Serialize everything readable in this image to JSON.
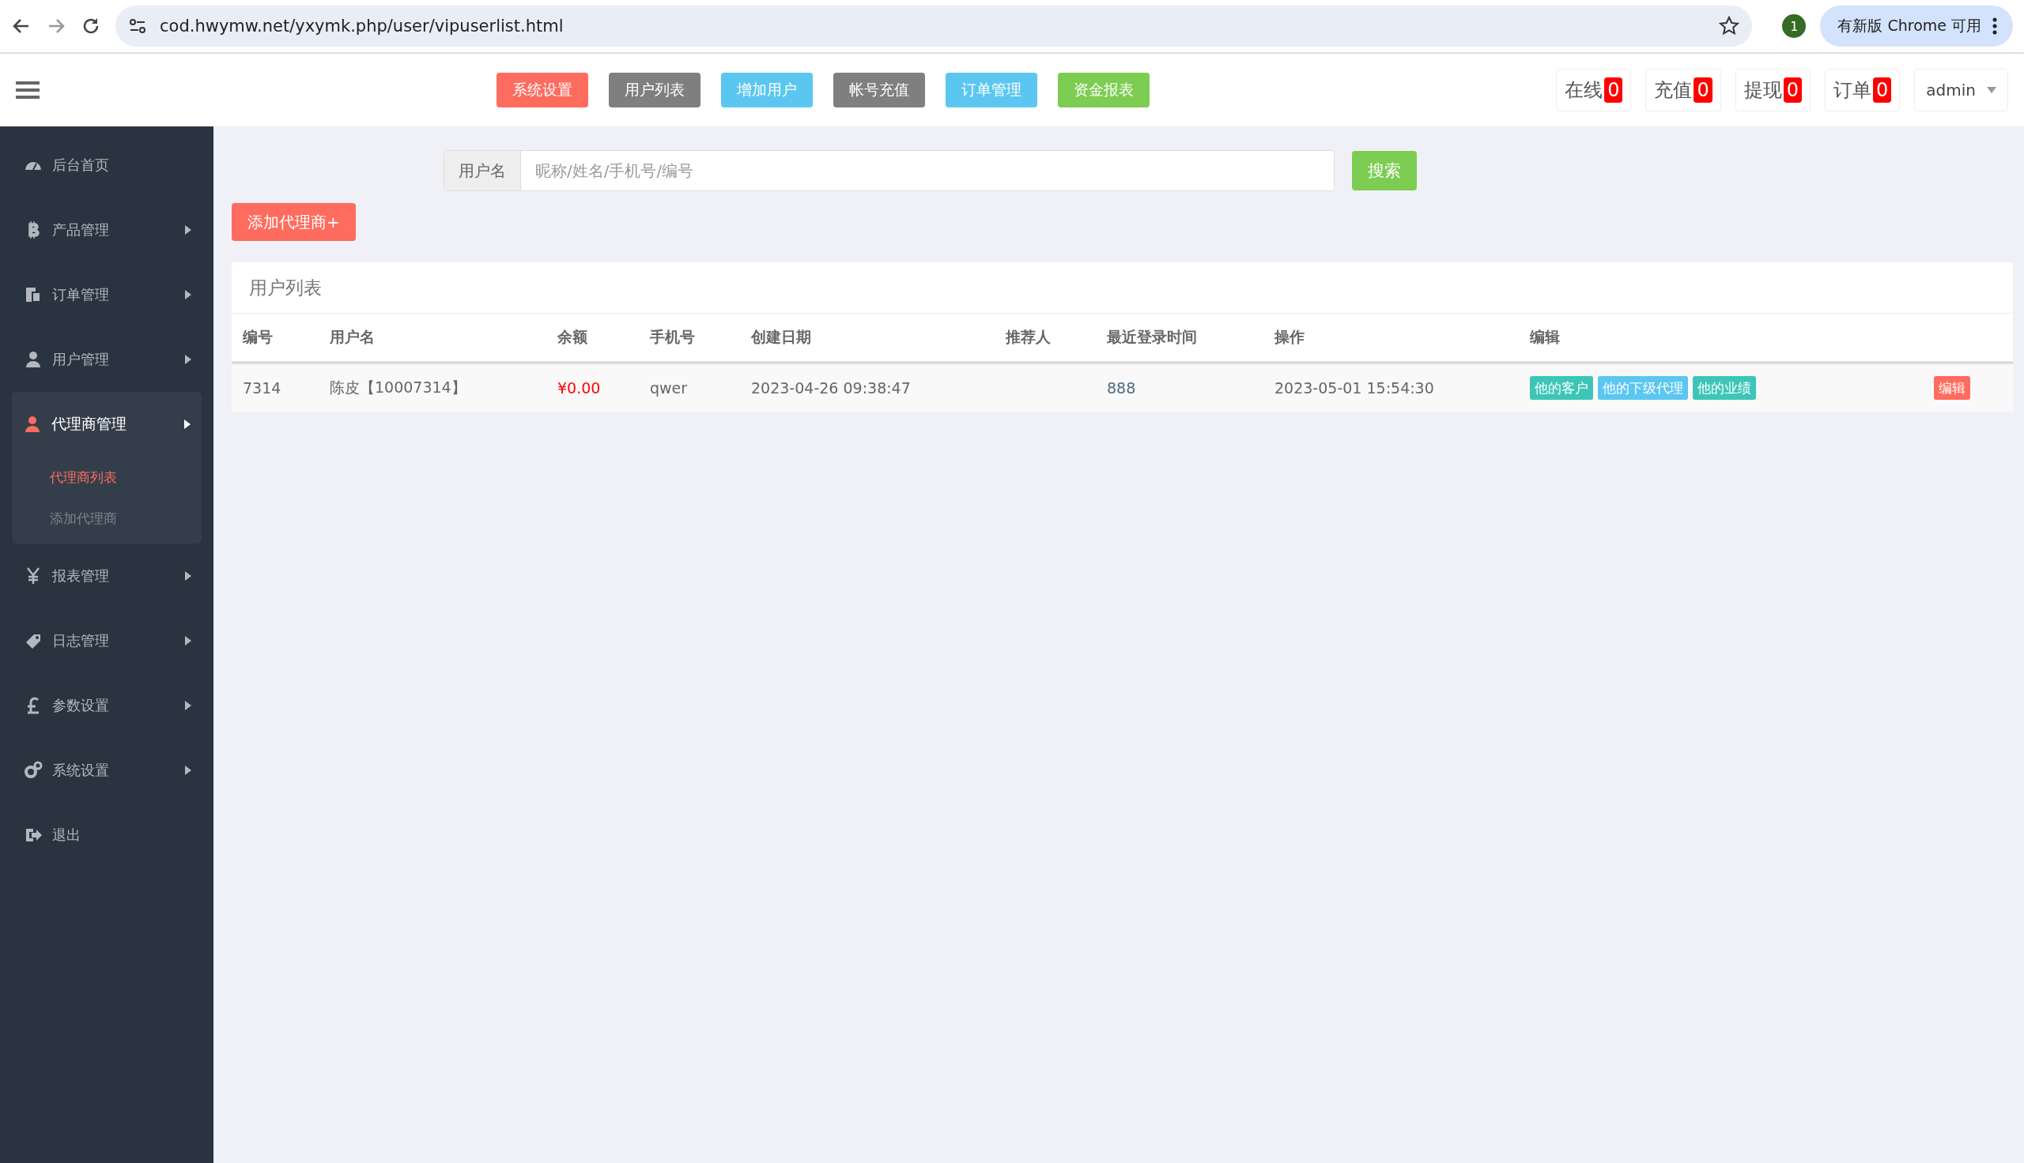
{
  "browser": {
    "url": "cod.hwymw.net/yxymk.php/user/vipuserlist.html",
    "profile_badge": "1",
    "update_button": "有新版 Chrome 可用"
  },
  "header": {
    "nav_buttons": [
      {
        "label": "系统设置",
        "color": "#fd6c5e"
      },
      {
        "label": "用户列表",
        "color": "#7f7f7f"
      },
      {
        "label": "增加用户",
        "color": "#5bc7f0"
      },
      {
        "label": "帐号充值",
        "color": "#7f7f7f"
      },
      {
        "label": "订单管理",
        "color": "#5bc7f0"
      },
      {
        "label": "资金报表",
        "color": "#7ccd52"
      }
    ],
    "counters": [
      {
        "label": "在线",
        "count": "0"
      },
      {
        "label": "充值",
        "count": "0"
      },
      {
        "label": "提现",
        "count": "0"
      },
      {
        "label": "订单",
        "count": "0"
      }
    ],
    "user": "admin"
  },
  "sidebar": {
    "items": [
      {
        "label": "后台首页",
        "has_arrow": false,
        "expanded": false
      },
      {
        "label": "产品管理",
        "has_arrow": true,
        "expanded": false
      },
      {
        "label": "订单管理",
        "has_arrow": true,
        "expanded": false
      },
      {
        "label": "用户管理",
        "has_arrow": true,
        "expanded": false
      },
      {
        "label": "代理商管理",
        "has_arrow": true,
        "expanded": true,
        "children": [
          {
            "label": "代理商列表",
            "selected": true
          },
          {
            "label": "添加代理商",
            "selected": false
          }
        ]
      },
      {
        "label": "报表管理",
        "has_arrow": true,
        "expanded": false
      },
      {
        "label": "日志管理",
        "has_arrow": true,
        "expanded": false
      },
      {
        "label": "参数设置",
        "has_arrow": true,
        "expanded": false
      },
      {
        "label": "系统设置",
        "has_arrow": true,
        "expanded": false
      },
      {
        "label": "退出",
        "has_arrow": false,
        "expanded": false
      }
    ]
  },
  "search": {
    "label": "用户名",
    "placeholder": "昵称/姓名/手机号/编号",
    "button": "搜索"
  },
  "add_button": "添加代理商+",
  "table": {
    "title": "用户列表",
    "columns": [
      "编号",
      "用户名",
      "余额",
      "手机号",
      "创建日期",
      "推荐人",
      "最近登录时间",
      "操作",
      "编辑"
    ],
    "rows": [
      {
        "cells": [
          "7314",
          "陈皮【10007314】",
          "¥0.00",
          "qwer",
          "2023-04-26 09:38:47",
          "",
          "888",
          "2023-05-01 15:54:30"
        ],
        "actions": [
          {
            "label": "他的客户",
            "color": "#3dc6b7"
          },
          {
            "label": "他的下级代理",
            "color": "#5bc7f0"
          },
          {
            "label": "他的业绩",
            "color": "#3dc6b7"
          }
        ],
        "edit": "编辑"
      }
    ]
  }
}
